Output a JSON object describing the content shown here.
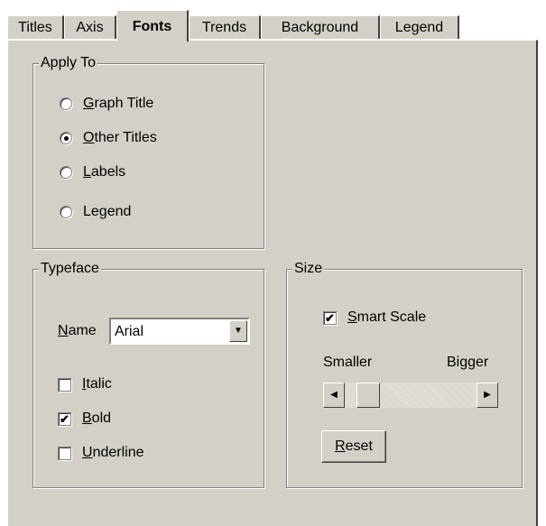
{
  "tabs": [
    {
      "label": "Titles"
    },
    {
      "label": "Axis"
    },
    {
      "label": "Fonts"
    },
    {
      "label": "Trends"
    },
    {
      "label": "Background"
    },
    {
      "label": "Legend"
    }
  ],
  "active_tab": "Fonts",
  "apply_to": {
    "title": "Apply To",
    "options": [
      {
        "mnemonic": "G",
        "rest": "raph Title",
        "selected": false
      },
      {
        "mnemonic": "O",
        "rest": "ther Titles",
        "selected": true
      },
      {
        "mnemonic": "L",
        "rest": "abels",
        "selected": false
      },
      {
        "pre": "Le",
        "mnemonic": "g",
        "rest": "end",
        "selected": false
      }
    ]
  },
  "typeface": {
    "title": "Typeface",
    "name_mnemonic": "N",
    "name_rest": "ame",
    "name_value": "Arial",
    "italic": {
      "mnemonic": "I",
      "rest": "talic",
      "checked": false
    },
    "bold": {
      "mnemonic": "B",
      "rest": "old",
      "checked": true
    },
    "underline": {
      "mnemonic": "U",
      "rest": "nderline",
      "checked": false
    }
  },
  "size": {
    "title": "Size",
    "smart_scale": {
      "mnemonic": "S",
      "rest": "mart Scale",
      "checked": true
    },
    "smaller_label": "Smaller",
    "bigger_label": "Bigger",
    "reset": {
      "mnemonic": "R",
      "rest": "eset"
    }
  },
  "icons": {
    "check": "✔",
    "scroll_left": "◀",
    "scroll_right": "▶",
    "dropdown": "▼"
  }
}
